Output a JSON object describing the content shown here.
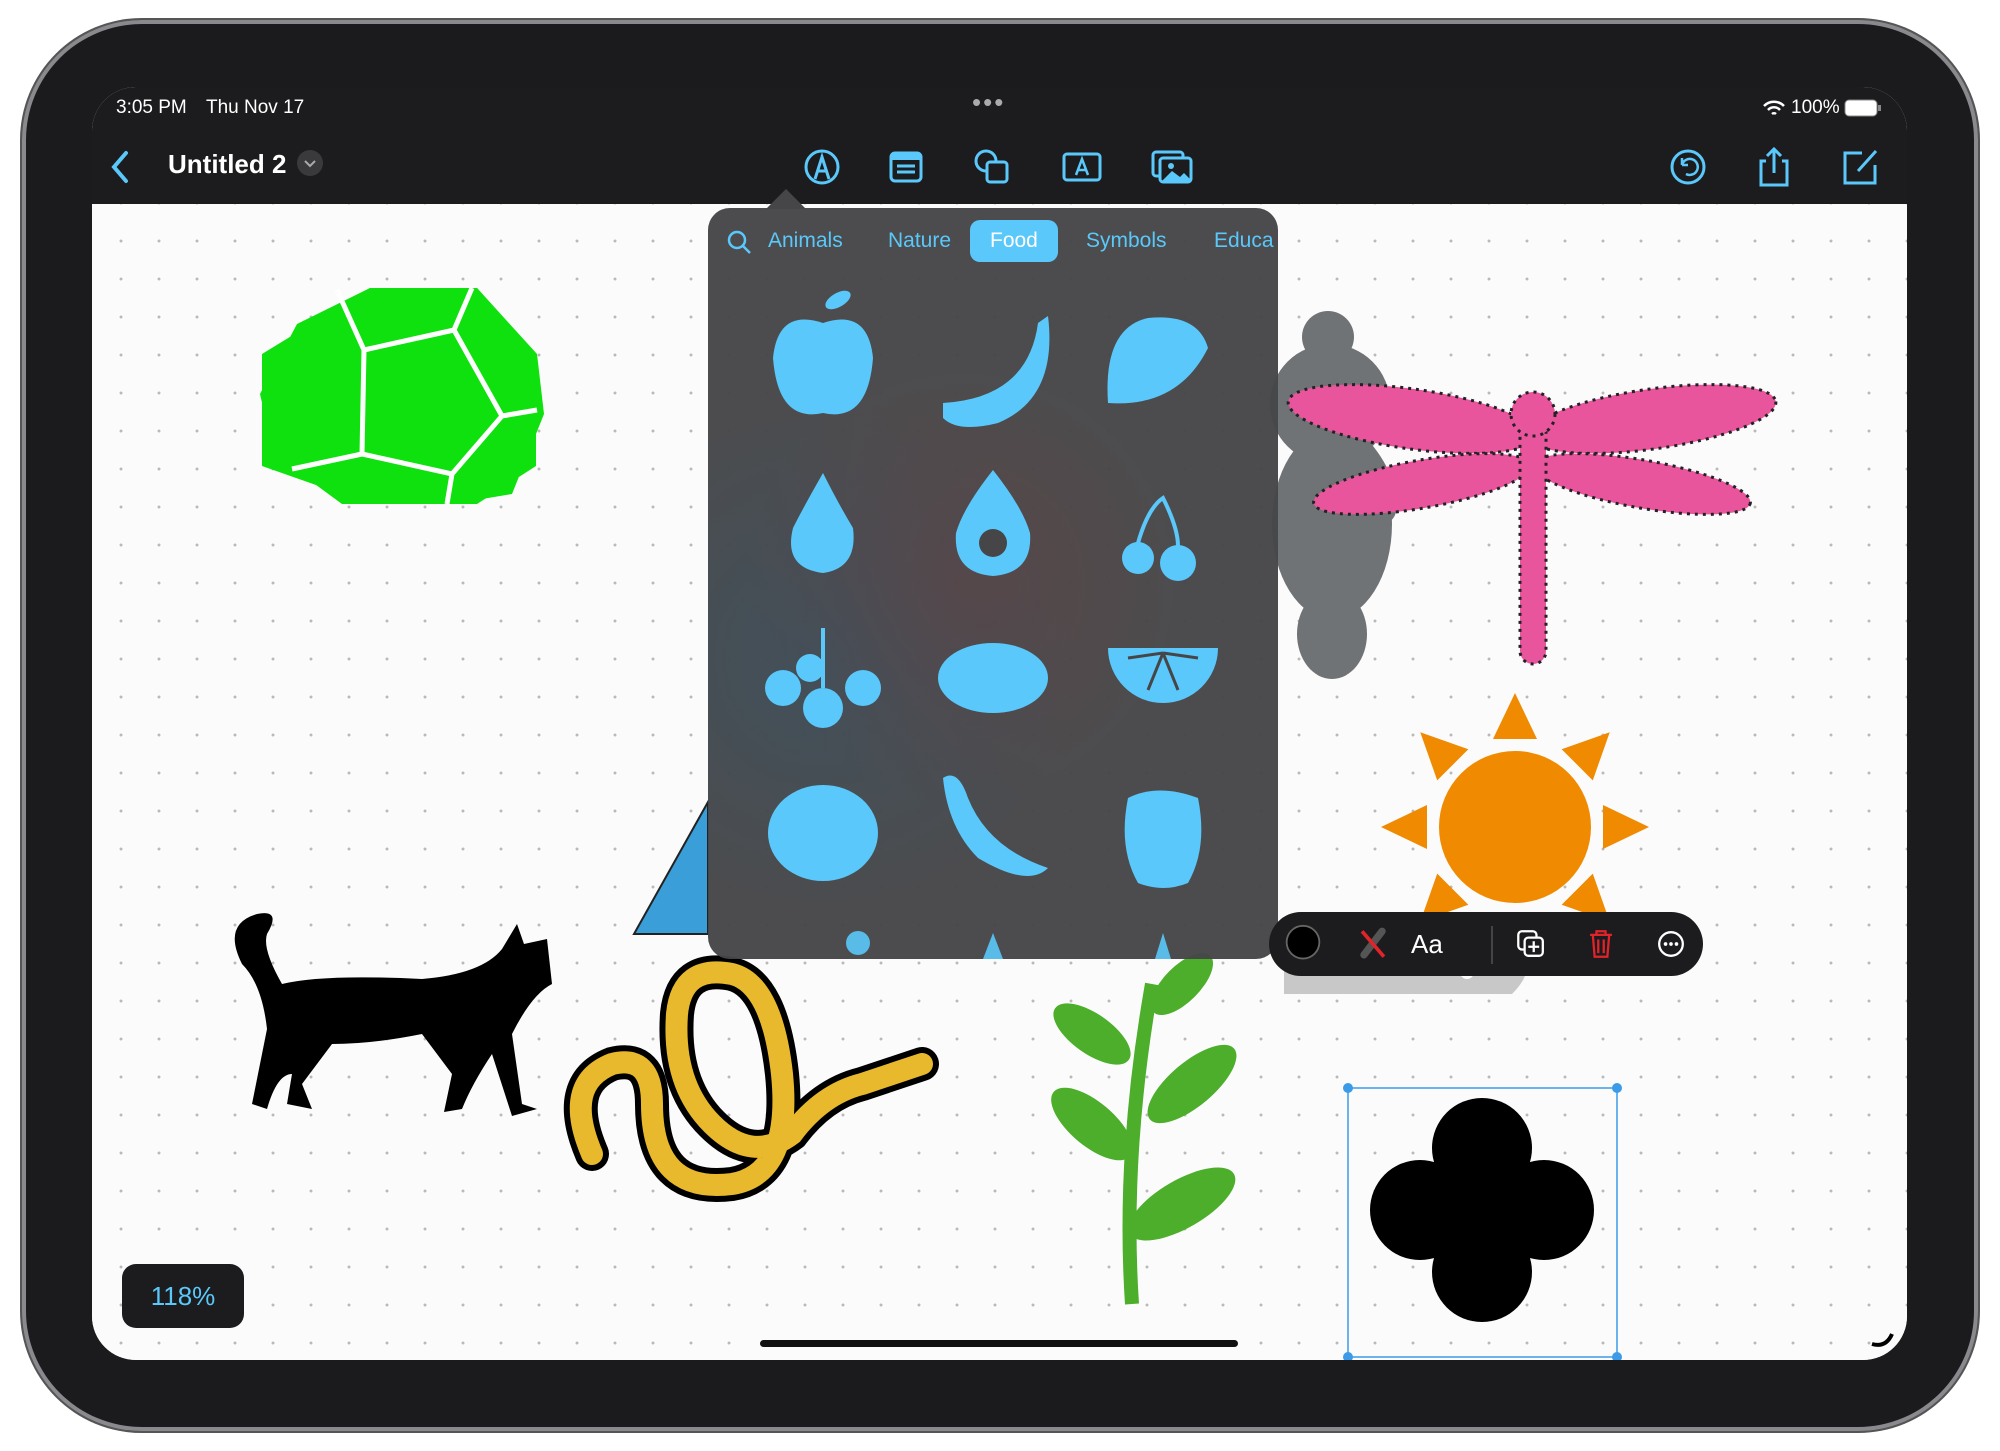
{
  "status_bar": {
    "time": "3:05 PM",
    "date": "Thu Nov 17",
    "battery": "100%",
    "wifi_icon": "wifi-icon",
    "battery_icon": "battery-icon"
  },
  "toolbar": {
    "title": "Untitled 2",
    "icons": [
      "pen-tool-icon",
      "note-icon",
      "shapes-icon",
      "text-box-icon",
      "media-icon"
    ],
    "right_icons": [
      "undo-icon",
      "share-icon",
      "compose-icon"
    ]
  },
  "shape_library": {
    "tabs": [
      "Animals",
      "Nature",
      "Food",
      "Symbols",
      "Educa"
    ],
    "selected_tab": "Food",
    "search_icon": "search-icon",
    "items": [
      "apple",
      "banana",
      "strawberry",
      "pear",
      "avocado",
      "cherries",
      "grapes",
      "lemon",
      "citrus slice",
      "tomato",
      "chili pepper",
      "bell pepper"
    ],
    "color": "#5ac8fa"
  },
  "context_menu": {
    "text_label": "Aa",
    "items": [
      "fill-color",
      "stroke-none",
      "text-style",
      "duplicate",
      "delete",
      "more"
    ]
  },
  "zoom_level": "118%",
  "colors": {
    "accent": "#5ac8fa",
    "toolbar": "#1c1c1e",
    "delete": "#e0242a",
    "hexagon": "#0ee10e",
    "sun": "#f08a00",
    "dragonfly": "#e8559c",
    "plant": "#4cae2a",
    "snake": "#e8b92c"
  }
}
